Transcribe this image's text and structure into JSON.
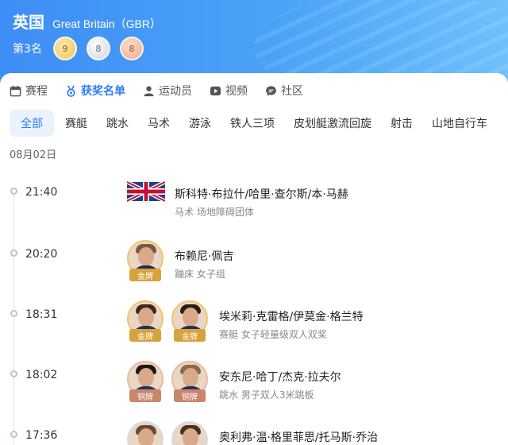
{
  "header": {
    "country_cn": "英国",
    "country_en": "Great Britain（GBR）",
    "rank": "第3名",
    "medals": {
      "gold": "9",
      "silver": "8",
      "bronze": "8"
    }
  },
  "tabs": [
    {
      "label": "赛程",
      "icon": "calendar-icon"
    },
    {
      "label": "获奖名单",
      "icon": "medal-icon",
      "active": true
    },
    {
      "label": "运动员",
      "icon": "person-icon"
    },
    {
      "label": "视频",
      "icon": "play-icon"
    },
    {
      "label": "社区",
      "icon": "chat-icon"
    }
  ],
  "sports": [
    "全部",
    "赛艇",
    "跳水",
    "马术",
    "游泳",
    "铁人三项",
    "皮划艇激流回旋",
    "射击",
    "山地自行车"
  ],
  "date": "08月02日",
  "events": [
    {
      "time": "21:40",
      "names": "斯科特·布拉什/哈里·查尔斯/本·马赫",
      "detail": "马术 场地障碍团体"
    },
    {
      "time": "20:20",
      "names": "布赖尼·佩吉",
      "detail": "蹦床 女子组",
      "medal": "金牌"
    },
    {
      "time": "18:31",
      "names": "埃米莉·克雷格/伊莫金·格兰特",
      "detail": "赛艇 女子轻量级双人双桨",
      "medal": "金牌"
    },
    {
      "time": "18:02",
      "names": "安东尼·哈丁/杰克·拉夫尔",
      "detail": "跳水 男子双人3米跳板",
      "medal": "铜牌"
    },
    {
      "time": "17:36",
      "names": "奥利弗·温·格里菲思/托马斯·乔治"
    }
  ]
}
